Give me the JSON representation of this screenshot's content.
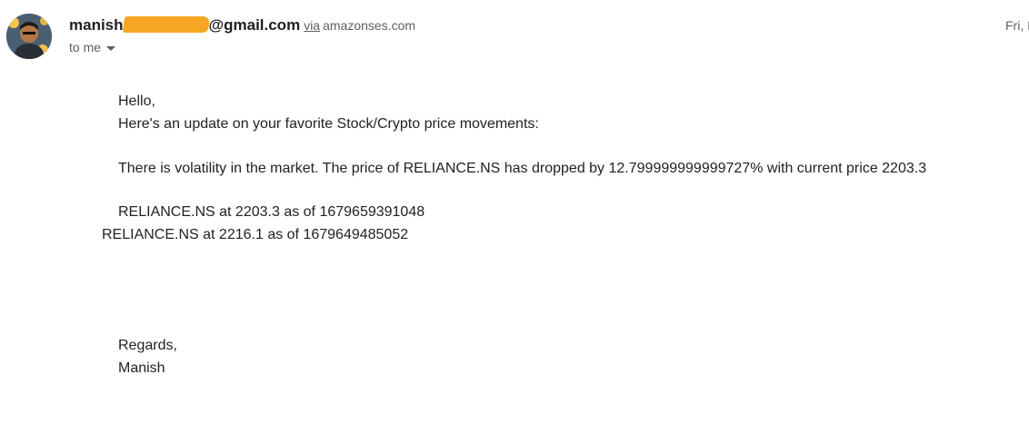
{
  "header": {
    "sender_prefix": "manish",
    "sender_suffix": "@gmail.com",
    "via_label": "via",
    "via_domain": "amazonses.com",
    "to_label": "to me",
    "date": "Fri, I"
  },
  "email": {
    "greeting": "Hello,",
    "intro": "Here's an update on your favorite Stock/Crypto price movements:",
    "alert": "There is volatility in the market. The price of RELIANCE.NS has dropped by 12.799999999999727% with current price 2203.3",
    "entry_1": "RELIANCE.NS at 2203.3 as of 1679659391048",
    "entry_2": "RELIANCE.NS at 2216.1 as of 1679649485052",
    "clipped_fragment": "%",
    "regards": "Regards,",
    "signature": "Manish"
  },
  "colors": {
    "redaction": "#f6a623",
    "secondary_text": "#5e5e5e"
  },
  "icons": {
    "avatar": "avatar-photo",
    "caret": "chevron-down-icon"
  }
}
